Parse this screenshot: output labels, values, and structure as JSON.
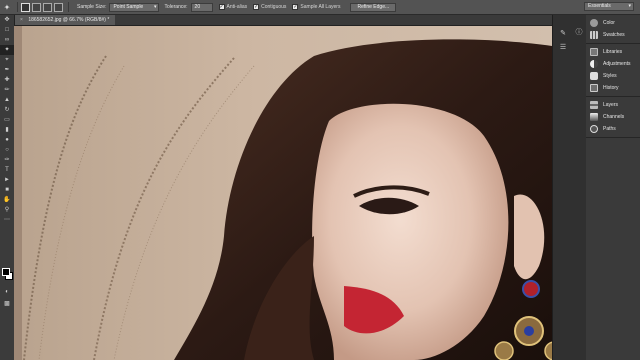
{
  "options_bar": {
    "sample_size_label": "Sample Size:",
    "sample_size_value": "Point Sample",
    "tolerance_label": "Tolerance:",
    "tolerance_value": "20",
    "anti_alias_label": "Anti-alias",
    "contiguous_label": "Contiguous",
    "sample_all_layers_label": "Sample All Layers",
    "refine_edge_label": "Refine Edge...",
    "workspace_value": "Essentials"
  },
  "document_tab": {
    "title": "186582652.jpg @ 66.7% (RGB/8#) *"
  },
  "panels": {
    "group1": [
      "Color",
      "Swatches"
    ],
    "group2": [
      "Libraries",
      "Adjustments",
      "Styles",
      "History"
    ],
    "group3": [
      "Layers",
      "Channels",
      "Paths"
    ]
  },
  "colors": {
    "ui_dark": "#282828",
    "options_bar": "#535353",
    "panel_bg": "#3a3a3a",
    "canvas_backdrop": "#c9b29c"
  }
}
